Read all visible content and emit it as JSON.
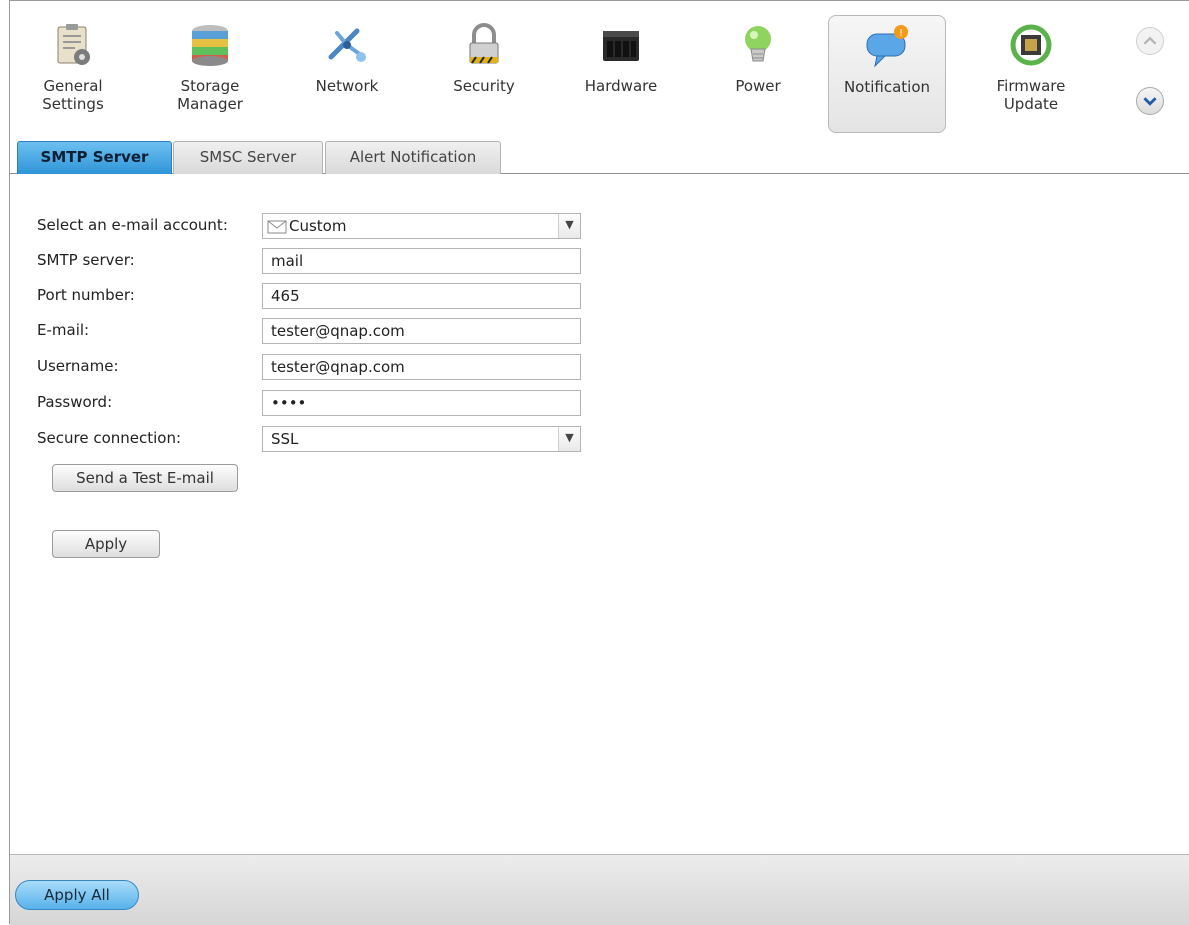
{
  "toolbar": {
    "items": [
      {
        "label": "General\nSettings",
        "icon": "general-settings-icon"
      },
      {
        "label": "Storage\nManager",
        "icon": "storage-manager-icon"
      },
      {
        "label": "Network",
        "icon": "network-icon"
      },
      {
        "label": "Security",
        "icon": "security-lock-icon"
      },
      {
        "label": "Hardware",
        "icon": "hardware-icon"
      },
      {
        "label": "Power",
        "icon": "power-bulb-icon"
      },
      {
        "label": "Notification",
        "icon": "notification-bubble-icon",
        "active": true
      },
      {
        "label": "Firmware\nUpdate",
        "icon": "firmware-update-icon"
      }
    ],
    "scroll_up_icon": "chevron-up-icon",
    "scroll_down_icon": "chevron-down-icon"
  },
  "tabs": [
    {
      "label": "SMTP Server",
      "active": true
    },
    {
      "label": "SMSC Server"
    },
    {
      "label": "Alert Notification"
    }
  ],
  "form": {
    "email_account": {
      "label": "Select an e-mail account:",
      "value": "Custom",
      "icon": "envelope-icon"
    },
    "smtp_server": {
      "label": "SMTP server:",
      "value": "mail"
    },
    "port_number": {
      "label": "Port number:",
      "value": "465"
    },
    "email": {
      "label": "E-mail:",
      "value": "tester@qnap.com"
    },
    "username": {
      "label": "Username:",
      "value": "tester@qnap.com"
    },
    "password": {
      "label": "Password:",
      "value": "••••"
    },
    "secure_connection": {
      "label": "Secure connection:",
      "value": "SSL"
    },
    "test_button": "Send a Test E-mail",
    "apply_button": "Apply"
  },
  "footer": {
    "apply_all_button": "Apply All"
  },
  "colors": {
    "active_tab": "#2f95d8",
    "apply_all": "#57b2ea"
  }
}
